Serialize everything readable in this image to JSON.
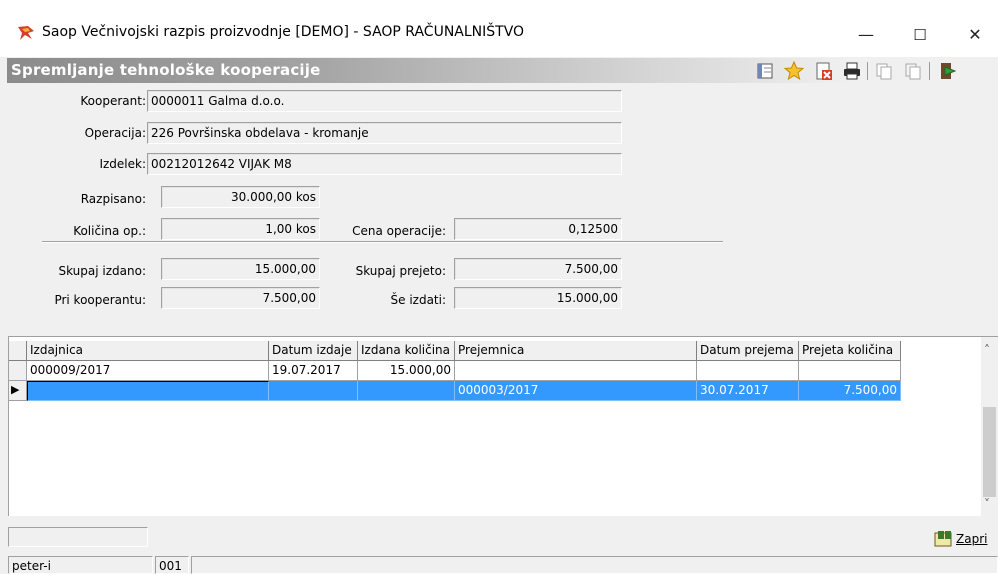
{
  "window": {
    "title": "Saop Večnivojski razpis proizvodnje [DEMO] - SAOP RAČUNALNIŠTVO",
    "minimize": "—",
    "maximize": "☐",
    "close": "✕"
  },
  "form": {
    "title": "Spremljanje tehnološke kooperacije",
    "toolbar_icons": [
      "layout-icon",
      "favorite-star-icon",
      "delete-document-icon",
      "print-icon",
      "copy-icon",
      "paste-icon",
      "exit-icon"
    ]
  },
  "fields": {
    "kooperant_label": "Kooperant:",
    "kooperant_value": "0000011 Galma d.o.o.",
    "operacija_label": "Operacija:",
    "operacija_value": "226 Površinska obdelava - kromanje",
    "izdelek_label": "Izdelek:",
    "izdelek_value": "00212012642 VIJAK M8",
    "razpisano_label": "Razpisano:",
    "razpisano_value": "30.000,00 kos",
    "kolicina_label": "Količina op.:",
    "kolicina_value": "1,00 kos",
    "cena_label": "Cena operacije:",
    "cena_value": "0,12500",
    "skupaj_izdano_label": "Skupaj izdano:",
    "skupaj_izdano_value": "15.000,00",
    "skupaj_prejeto_label": "Skupaj prejeto:",
    "skupaj_prejeto_value": "7.500,00",
    "pri_kooperantu_label": "Pri kooperantu:",
    "pri_kooperantu_value": "7.500,00",
    "se_izdati_label": "Še izdati:",
    "se_izdati_value": "15.000,00"
  },
  "grid": {
    "columns": [
      "Izdajnica",
      "Datum izdaje",
      "Izdana količina",
      "Prejemnica",
      "Datum prejema",
      "Prejeta količina"
    ],
    "rows": [
      [
        "000009/2017",
        "19.07.2017",
        "15.000,00",
        "",
        "",
        ""
      ],
      [
        "",
        "",
        "",
        "000003/2017",
        "30.07.2017",
        "7.500,00"
      ]
    ],
    "row_indicator": "▶",
    "scroll_up": "˄",
    "scroll_down": "˅"
  },
  "footer": {
    "close_button": "Zapri",
    "status_user": "peter-i",
    "status_code": "001"
  },
  "colors": {
    "selection": "#3399ff",
    "subheader_gradient_start": "#8b8b8b"
  }
}
